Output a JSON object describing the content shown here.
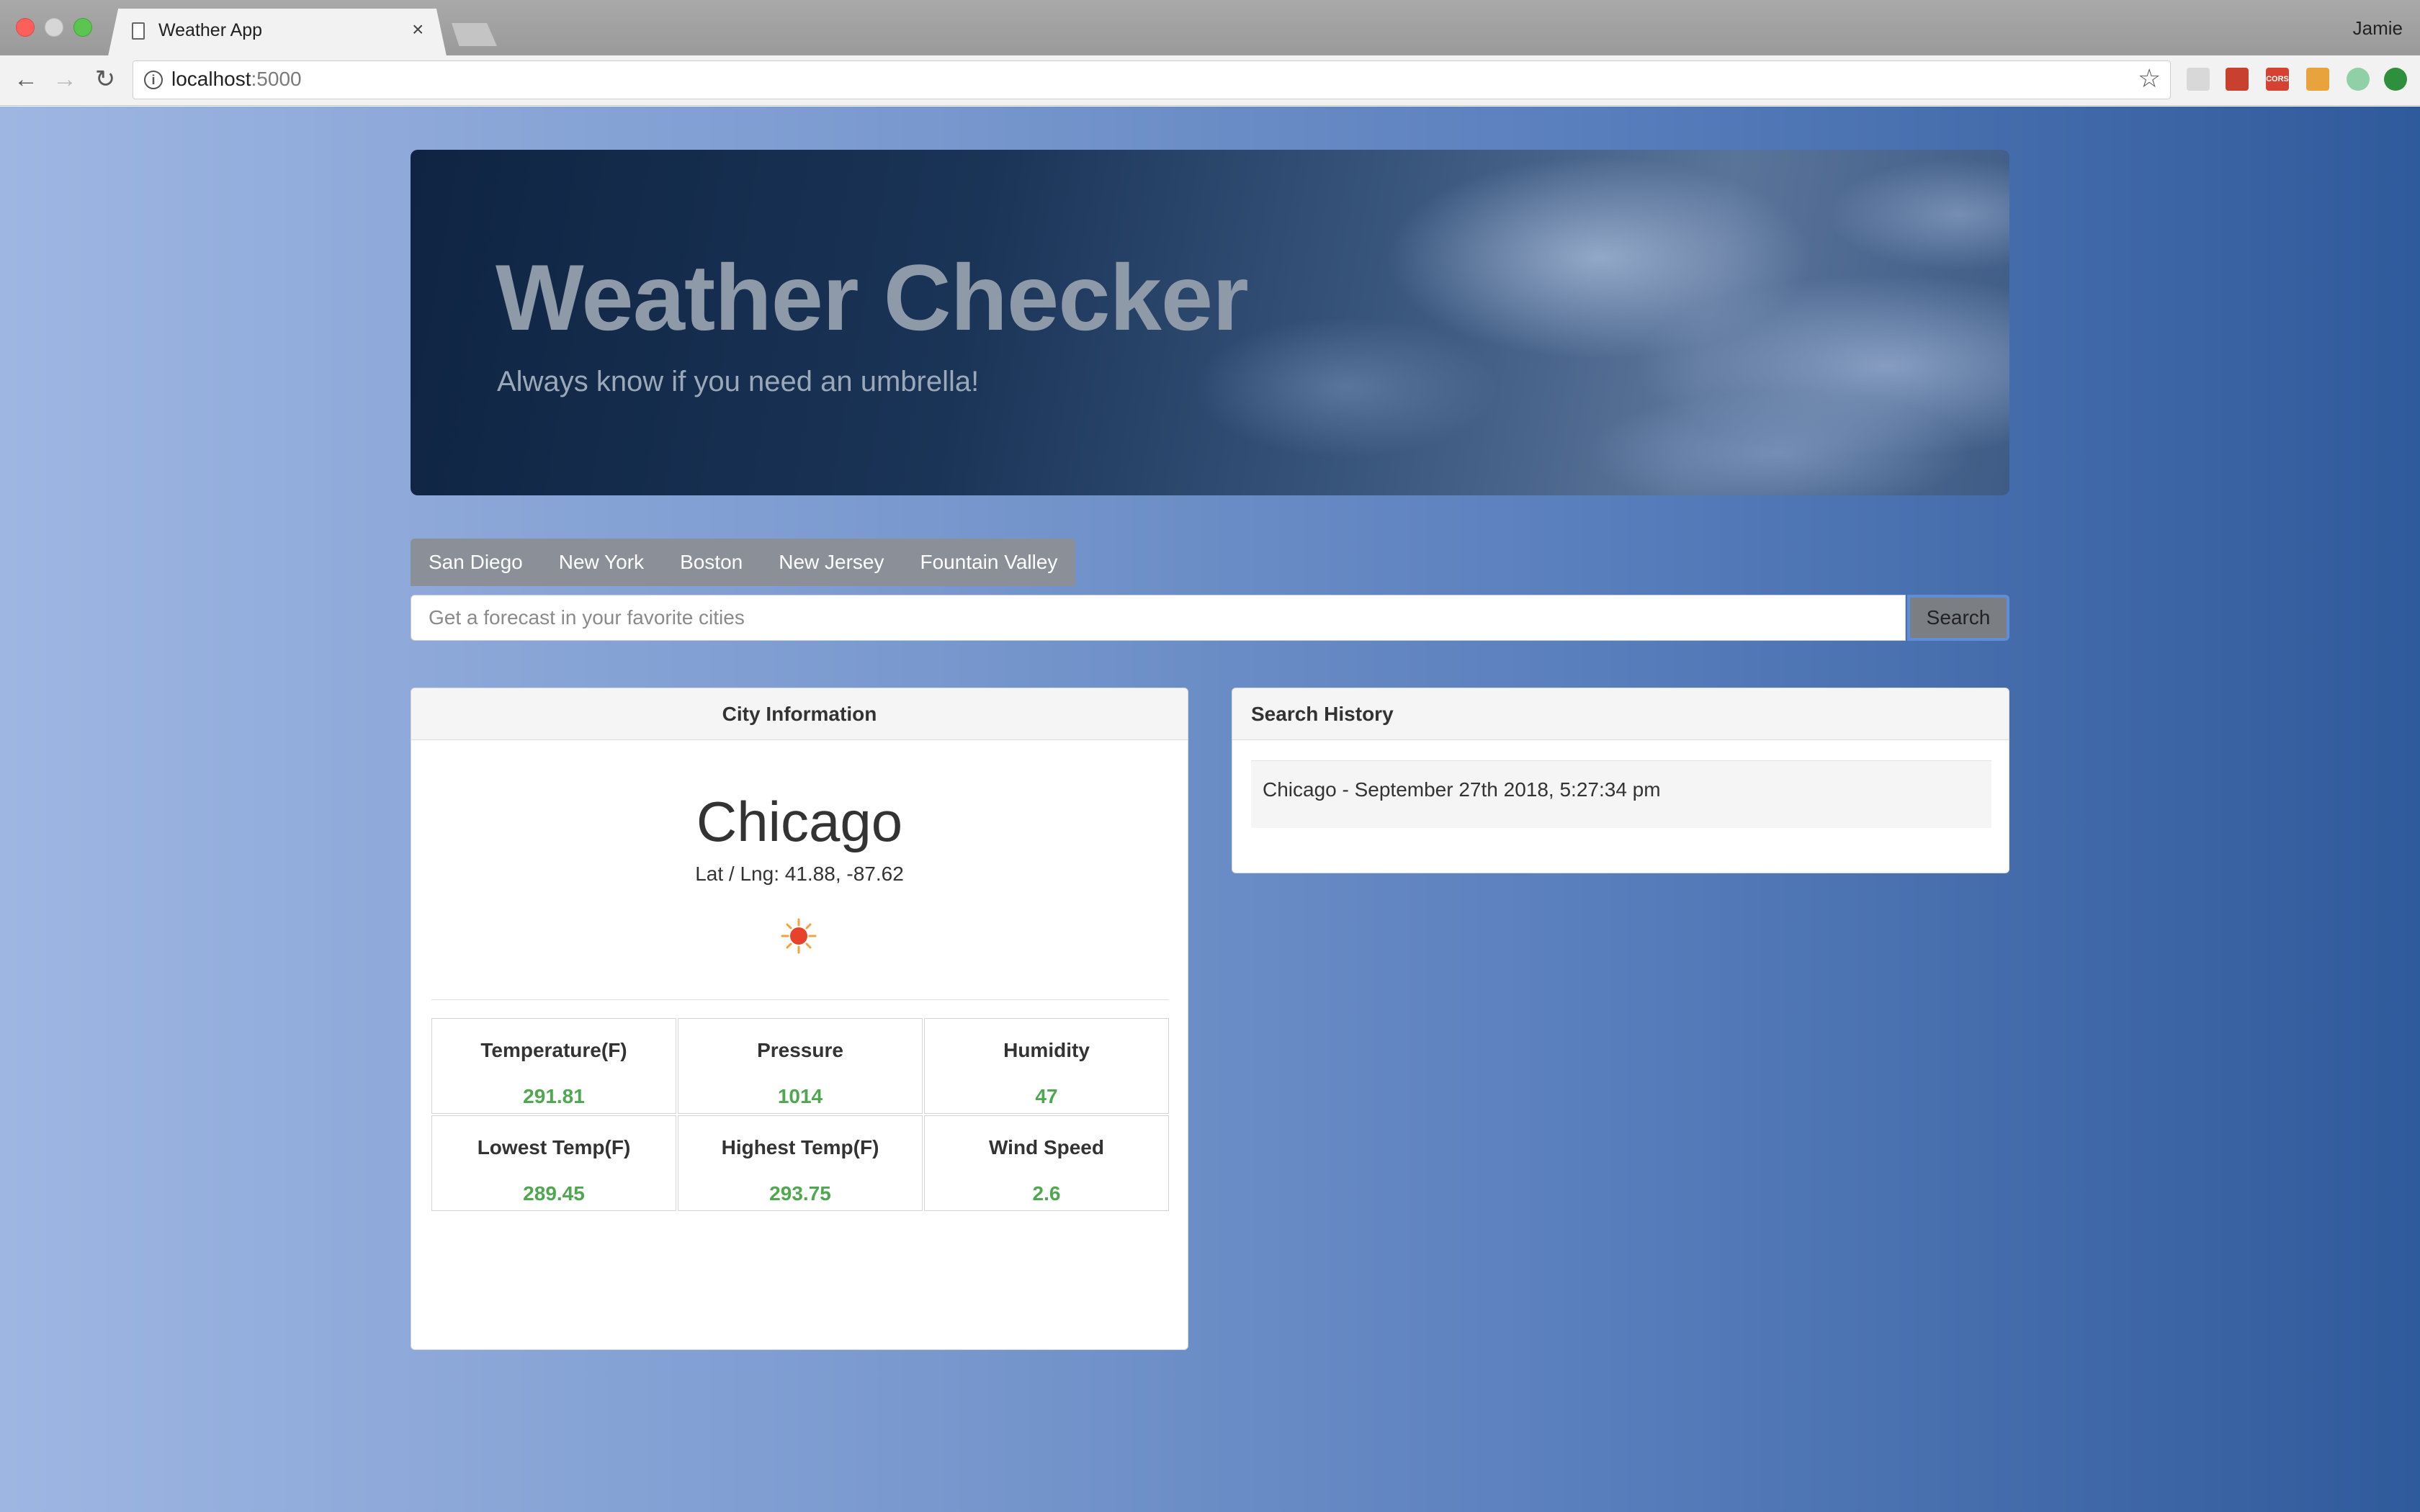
{
  "browser": {
    "tab_title": "Weather App",
    "tab_close": "×",
    "profile": "Jamie",
    "url_host": "localhost",
    "url_port": ":5000",
    "icons": [
      "back-arrow-icon",
      "forward-arrow-icon",
      "reload-icon",
      "info-icon",
      "star-icon"
    ]
  },
  "header": {
    "title": "Weather Checker",
    "subtitle": "Always know if you need an umbrella!"
  },
  "city_tabs": [
    "San Diego",
    "New York",
    "Boston",
    "New Jersey",
    "Fountain Valley"
  ],
  "search": {
    "placeholder": "Get a forecast in your favorite cities",
    "value": "",
    "button": "Search"
  },
  "city_panel": {
    "heading": "City Information",
    "city": "Chicago",
    "latlng": "Lat / Lng: 41.88, -87.62",
    "weather_icon": "sun-icon",
    "stats": [
      {
        "label": "Temperature(F)",
        "value": "291.81"
      },
      {
        "label": "Pressure",
        "value": "1014"
      },
      {
        "label": "Humidity",
        "value": "47"
      },
      {
        "label": "Lowest Temp(F)",
        "value": "289.45"
      },
      {
        "label": "Highest Temp(F)",
        "value": "293.75"
      },
      {
        "label": "Wind Speed",
        "value": "2.6"
      }
    ]
  },
  "history_panel": {
    "heading": "Search History",
    "items": [
      "Chicago - September 27th 2018, 5:27:34 pm"
    ]
  },
  "colors": {
    "stat_value": "#4fa84f",
    "tab_bg": "#8a8f98",
    "search_button_bg": "#7b7e82"
  }
}
